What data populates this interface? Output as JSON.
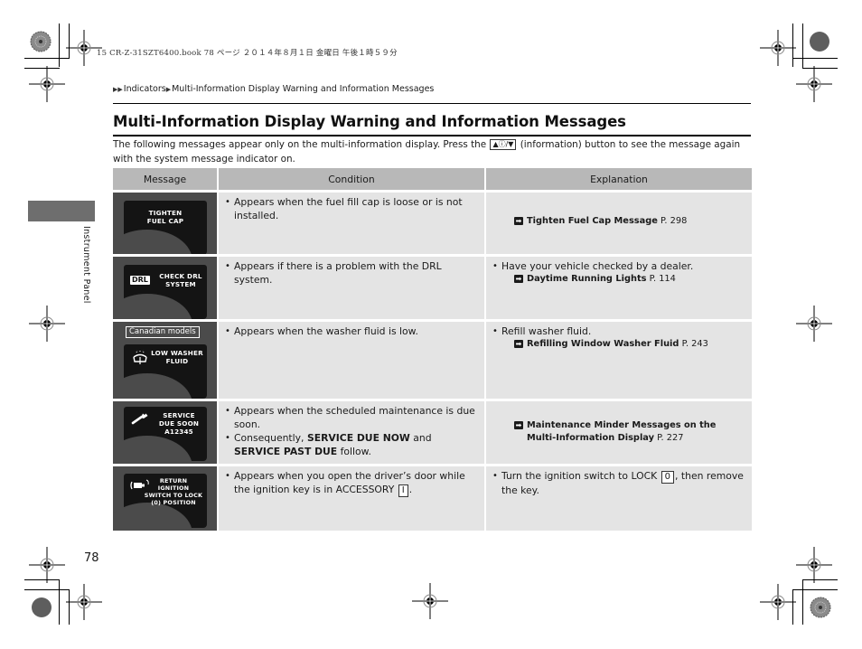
{
  "book_header": "15 CR-Z-31SZT6400.book  78 ページ  ２０１４年８月１日  金曜日  午後１時５９分",
  "breadcrumb": {
    "items": [
      "Indicators",
      "Multi-Information Display Warning and Information Messages"
    ],
    "separator_icon": "triangle-right-icon"
  },
  "title": "Multi-Information Display Warning and Information Messages",
  "intro": {
    "before": "The following messages appear only on the multi-information display. Press the ",
    "button_glyph": "▲ⓘ/▼",
    "after": " (information) button to see the message again with the system message indicator on."
  },
  "side_tab": {
    "label": "Instrument Panel"
  },
  "table": {
    "headers": [
      "Message",
      "Condition",
      "Explanation"
    ],
    "rows": [
      {
        "screen": {
          "lines": [
            "TIGHTEN",
            "FUEL CAP"
          ]
        },
        "conditions": [
          "Appears when the fuel fill cap is loose or is not installed."
        ],
        "explanation": [],
        "refs": [
          {
            "title": "Tighten Fuel Cap Message",
            "page": "P. 298"
          }
        ]
      },
      {
        "screen": {
          "badge": "DRL",
          "lines": [
            "CHECK DRL",
            "SYSTEM"
          ]
        },
        "conditions": [
          "Appears if there is a problem with the DRL system."
        ],
        "explanation": [
          "Have your vehicle checked by a dealer."
        ],
        "refs": [
          {
            "title": "Daytime Running Lights",
            "page": "P. 114"
          }
        ]
      },
      {
        "screen": {
          "tag": "Canadian models",
          "icon": "washer-fluid-icon",
          "lines": [
            "LOW WASHER",
            "FLUID"
          ]
        },
        "conditions": [
          "Appears when the washer fluid is low."
        ],
        "explanation": [
          "Refill washer fluid."
        ],
        "refs": [
          {
            "title": "Refilling Window Washer Fluid",
            "page": "P. 243"
          }
        ]
      },
      {
        "screen": {
          "icon": "wrench-icon",
          "lines": [
            "SERVICE",
            "DUE SOON",
            "A12345"
          ]
        },
        "conditions": [
          "Appears when the scheduled maintenance is due soon.",
          {
            "pre": "Consequently, ",
            "b1": "SERVICE DUE NOW",
            "mid": " and ",
            "b2": "SERVICE PAST DUE",
            "post": " follow."
          }
        ],
        "explanation": [],
        "refs": [
          {
            "title": "Maintenance Minder Messages on the Multi-Information Display",
            "page": "P. 227"
          }
        ]
      },
      {
        "screen": {
          "icon": "key-door-icon",
          "lines": [
            "RETURN",
            "IGNITION",
            "SWITCH TO LOCK",
            "(0) POSITION"
          ]
        },
        "conditions": [
          {
            "pre": "Appears when you open the driver’s door while the ignition key is in ACCESSORY ",
            "key": "I",
            "post": "."
          }
        ],
        "explanation": [
          {
            "pre": "Turn the ignition switch to LOCK ",
            "key": "0",
            "post": ", then remove the key."
          }
        ],
        "refs": []
      }
    ]
  },
  "page_number": "78",
  "colors": {
    "table_header": "#b8b8b8",
    "cell_bg": "#e4e4e4",
    "screen_frame": "#4b4b4b",
    "screen_bg": "#141414",
    "side_tab": "#6e6e6e"
  }
}
